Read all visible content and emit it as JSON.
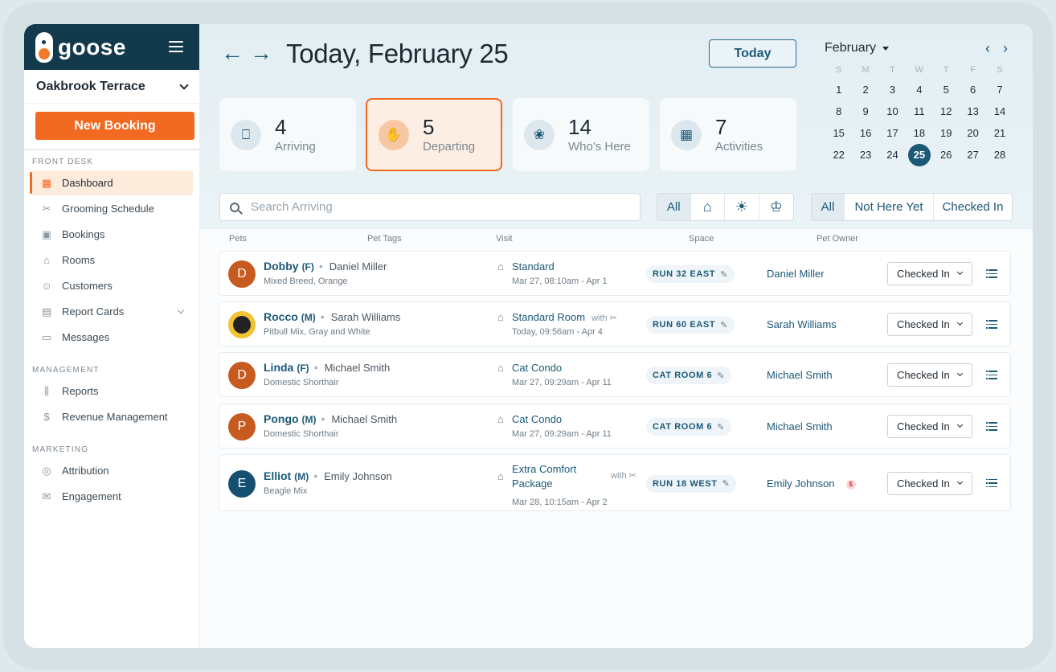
{
  "brand": {
    "name": "goose"
  },
  "location": {
    "name": "Oakbrook Terrace"
  },
  "new_booking_label": "New Booking",
  "sidebar": {
    "sections": [
      {
        "title": "FRONT DESK",
        "items": [
          {
            "label": "Dashboard",
            "icon": "dashboard-icon",
            "glyph": "▦",
            "active": true
          },
          {
            "label": "Grooming Schedule",
            "icon": "scissors-icon",
            "glyph": "✂"
          },
          {
            "label": "Bookings",
            "icon": "calendar-check-icon",
            "glyph": "▣"
          },
          {
            "label": "Rooms",
            "icon": "house-icon",
            "glyph": "⌂"
          },
          {
            "label": "Customers",
            "icon": "users-icon",
            "glyph": "☺"
          },
          {
            "label": "Report Cards",
            "icon": "document-icon",
            "glyph": "▤",
            "has_chevron": true
          },
          {
            "label": "Messages",
            "icon": "message-icon",
            "glyph": "▭"
          }
        ]
      },
      {
        "title": "MANAGEMENT",
        "items": [
          {
            "label": "Reports",
            "icon": "bar-chart-icon",
            "glyph": "⫼"
          },
          {
            "label": "Revenue Management",
            "icon": "dollar-icon",
            "glyph": "$"
          }
        ]
      },
      {
        "title": "MARKETING",
        "items": [
          {
            "label": "Attribution",
            "icon": "target-icon",
            "glyph": "◎"
          },
          {
            "label": "Engagement",
            "icon": "mail-icon",
            "glyph": "✉"
          }
        ]
      }
    ]
  },
  "header": {
    "title": "Today, February 25",
    "today_label": "Today",
    "prev_icon": "arrow-left-icon",
    "next_icon": "arrow-right-icon"
  },
  "stats": [
    {
      "num": "4",
      "label": "Arriving",
      "icon": "door-icon",
      "glyph": "⎕"
    },
    {
      "num": "5",
      "label": "Departing",
      "icon": "wave-hand-icon",
      "glyph": "✋",
      "active": true
    },
    {
      "num": "14",
      "label": "Who's Here",
      "icon": "paw-icon",
      "glyph": "❀"
    },
    {
      "num": "7",
      "label": "Activities",
      "icon": "calendar-list-icon",
      "glyph": "▦"
    }
  ],
  "calendar": {
    "month": "February",
    "dow": [
      "S",
      "M",
      "T",
      "W",
      "T",
      "F",
      "S"
    ],
    "weeks": [
      [
        "1",
        "2",
        "3",
        "4",
        "5",
        "6",
        "7"
      ],
      [
        "8",
        "9",
        "10",
        "11",
        "12",
        "13",
        "14"
      ],
      [
        "15",
        "16",
        "17",
        "18",
        "19",
        "20",
        "21"
      ],
      [
        "22",
        "23",
        "24",
        "25",
        "26",
        "27",
        "28"
      ]
    ],
    "selected": "25"
  },
  "search": {
    "placeholder": "Search Arriving"
  },
  "type_filter": [
    {
      "label": "All",
      "active": true
    },
    {
      "icon": "house-icon",
      "glyph": "⌂"
    },
    {
      "icon": "sun-icon",
      "glyph": "☀"
    },
    {
      "icon": "groomer-icon",
      "glyph": "♔"
    }
  ],
  "status_filter": [
    {
      "label": "All",
      "active": true
    },
    {
      "label": "Not Here Yet"
    },
    {
      "label": "Checked In"
    }
  ],
  "table": {
    "columns": [
      "Pets",
      "Pet Tags",
      "Visit",
      "Space",
      "Pet Owner"
    ],
    "rows": [
      {
        "initial": "D",
        "avatar": "orange",
        "name": "Dobby",
        "sex": "(F)",
        "owner_inline": "Daniel Miller",
        "breed": "Mixed Breed, Orange",
        "visit": "Standard",
        "visit_with": "",
        "visit_date": "Mar 27, 08:10am - Apr 1",
        "space": "RUN 32 EAST",
        "owner": "Daniel Miller",
        "status": "Checked In",
        "owner_badge": ""
      },
      {
        "initial": "",
        "avatar": "photo",
        "name": "Rocco",
        "sex": "(M)",
        "owner_inline": "Sarah Williams",
        "breed": "Pitbull Mix, Gray and White",
        "visit": "Standard Room",
        "visit_with": "with",
        "visit_date": "Today, 09:56am - Apr 4",
        "space": "RUN 60 EAST",
        "owner": "Sarah Williams",
        "status": "Checked In",
        "owner_badge": ""
      },
      {
        "initial": "D",
        "avatar": "orange",
        "name": "Linda",
        "sex": "(F)",
        "owner_inline": "Michael Smith",
        "breed": "Domestic Shorthair",
        "visit": "Cat Condo",
        "visit_with": "",
        "visit_date": "Mar 27, 09:29am - Apr 11",
        "space": "CAT ROOM 6",
        "owner": "Michael Smith",
        "status": "Checked In",
        "owner_badge": ""
      },
      {
        "initial": "P",
        "avatar": "orange",
        "name": "Pongo",
        "sex": "(M)",
        "owner_inline": "Michael Smith",
        "breed": "Domestic Shorthair",
        "visit": "Cat Condo",
        "visit_with": "",
        "visit_date": "Mar 27, 09:29am - Apr 11",
        "space": "CAT ROOM 6",
        "owner": "Michael Smith",
        "status": "Checked In",
        "owner_badge": ""
      },
      {
        "initial": "E",
        "avatar": "navy",
        "name": "Elliot",
        "sex": "(M)",
        "owner_inline": "Emily Johnson",
        "breed": "Beagle Mix",
        "visit": "Extra Comfort Package",
        "visit_with": "with",
        "visit_date": "Mar 28, 10:15am - Apr 2",
        "space": "RUN 18 WEST",
        "owner": "Emily Johnson",
        "status": "Checked In",
        "owner_badge": "$"
      }
    ]
  },
  "colors": {
    "brand_navy": "#123a4c",
    "accent_orange": "#f26a21",
    "link_blue": "#1b5977"
  }
}
